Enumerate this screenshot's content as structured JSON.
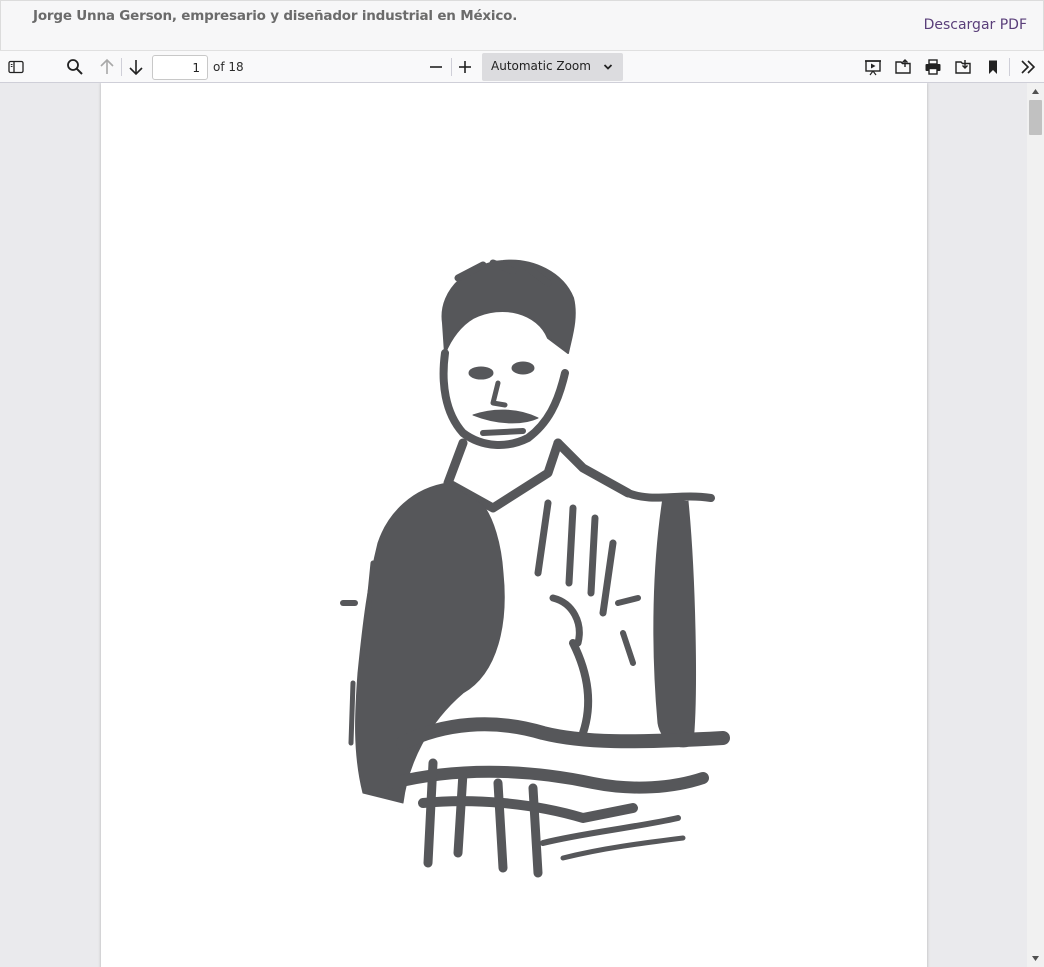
{
  "header": {
    "document_title": "Jorge Unna Gerson, empresario y diseñador industrial en México.",
    "download_label": "Descargar PDF",
    "link_color": "#5a3f7a"
  },
  "toolbar": {
    "sidebar_toggle_icon": "sidebar-toggle-icon",
    "search_icon": "search-icon",
    "previous_page_icon": "arrow-up-icon",
    "next_page_icon": "arrow-down-icon",
    "page_number": "1",
    "page_count": "of 18",
    "zoom_out_icon": "minus-icon",
    "zoom_in_icon": "plus-icon",
    "zoom_value": "Automatic Zoom",
    "presentation_icon": "presentation-mode-icon",
    "open_file_icon": "open-file-icon",
    "print_icon": "print-icon",
    "download_icon": "download-icon",
    "bookmark_icon": "bookmark-icon",
    "tools_icon": "double-chevron-right-icon"
  },
  "viewer": {
    "current_page": 1,
    "page_content": "ink-sketch-portrait",
    "scroll_position": 0.0
  }
}
